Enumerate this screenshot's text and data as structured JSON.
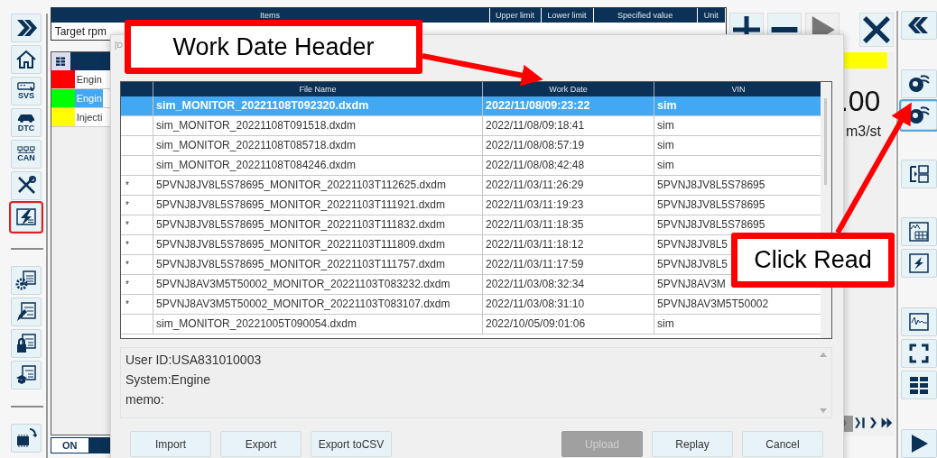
{
  "left_toolbar": {
    "groups": [
      [
        {
          "kind": "forward",
          "selected": false
        },
        {
          "kind": "home",
          "selected": false
        },
        {
          "kind": "svs",
          "label": "SVS",
          "selected": false
        },
        {
          "kind": "dtc",
          "label": "DTC",
          "selected": false
        },
        {
          "kind": "can",
          "label": "CAN",
          "selected": false
        },
        {
          "kind": "tools",
          "selected": false
        },
        {
          "kind": "monitor",
          "selected": true
        }
      ],
      [
        {
          "kind": "settings-list",
          "selected": false
        },
        {
          "kind": "edit-list",
          "selected": false
        },
        {
          "kind": "lock-list",
          "selected": false
        },
        {
          "kind": "learn-list",
          "selected": false
        }
      ],
      [
        {
          "kind": "chip",
          "selected": false
        }
      ]
    ]
  },
  "params_table": {
    "columns": [
      "Items",
      "Upper limit",
      "Lower limit",
      "Specified value",
      "Unit"
    ],
    "row_label": "Target rpm"
  },
  "signals": [
    {
      "color": "#ff0000",
      "label": "Engin",
      "selected": false
    },
    {
      "color": "#00ff00",
      "label": "Engin",
      "selected": true
    },
    {
      "color": "#ffff00",
      "label": "Injecti",
      "selected": false
    }
  ],
  "mode_buttons": [
    {
      "label": "ON",
      "selected": false
    },
    {
      "selected": true
    }
  ],
  "top_buttons": [
    {
      "kind": "add",
      "disabled": false
    },
    {
      "kind": "remove",
      "disabled": false
    },
    {
      "kind": "play",
      "disabled": true
    },
    {
      "kind": "close",
      "disabled": false
    }
  ],
  "value_panel": {
    "value": ".00",
    "unit": "m3/st"
  },
  "page_nav": [
    {
      "kind": "first",
      "disabled": true
    },
    {
      "kind": "last",
      "disabled": false
    },
    {
      "kind": "next",
      "disabled": false
    },
    {
      "kind": "fast",
      "disabled": false
    }
  ],
  "right_toolbar": {
    "groups": [
      [
        {
          "kind": "back",
          "selected": false
        }
      ],
      [
        {
          "kind": "disc",
          "selected": false
        },
        {
          "kind": "disc",
          "selected": true
        }
      ],
      [
        {
          "kind": "transfer",
          "selected": false
        }
      ],
      [
        {
          "kind": "graph-table",
          "selected": false
        },
        {
          "kind": "lightning",
          "selected": false
        }
      ],
      [
        {
          "kind": "waveform",
          "selected": false
        },
        {
          "kind": "fullscreen",
          "selected": false
        },
        {
          "kind": "grid",
          "selected": false
        }
      ],
      [
        {
          "kind": "play",
          "selected": false
        }
      ]
    ]
  },
  "dialog": {
    "title": "[D",
    "columns": [
      "File Name",
      "Work Date",
      "VIN"
    ],
    "rows": [
      {
        "file": "sim_MONITOR_20221108T092320.dxdm",
        "date": "2022/11/08/09:23:22",
        "vin": "sim",
        "selected": true
      },
      {
        "file": "sim_MONITOR_20221108T091518.dxdm",
        "date": "2022/11/08/09:18:41",
        "vin": "sim",
        "selected": false
      },
      {
        "file": "sim_MONITOR_20221108T085718.dxdm",
        "date": "2022/11/08/08:57:19",
        "vin": "sim",
        "selected": false
      },
      {
        "file": "sim_MONITOR_20221108T084246.dxdm",
        "date": "2022/11/08/08:42:48",
        "vin": "sim",
        "selected": false
      },
      {
        "mark": "*",
        "file": "5PVNJ8JV8L5S78695_MONITOR_20221103T112625.dxdm",
        "date": "2022/11/03/11:26:29",
        "vin": "5PVNJ8JV8L5S78695",
        "selected": false
      },
      {
        "mark": "*",
        "file": "5PVNJ8JV8L5S78695_MONITOR_20221103T111921.dxdm",
        "date": "2022/11/03/11:19:23",
        "vin": "5PVNJ8JV8L5S78695",
        "selected": false
      },
      {
        "mark": "*",
        "file": "5PVNJ8JV8L5S78695_MONITOR_20221103T111832.dxdm",
        "date": "2022/11/03/11:18:35",
        "vin": "5PVNJ8JV8L5S78695",
        "selected": false
      },
      {
        "mark": "*",
        "file": "5PVNJ8JV8L5S78695_MONITOR_20221103T111809.dxdm",
        "date": "2022/11/03/11:18:12",
        "vin": "5PVNJ8JV8L5",
        "selected": false
      },
      {
        "mark": "*",
        "file": "5PVNJ8JV8L5S78695_MONITOR_20221103T111757.dxdm",
        "date": "2022/11/03/11:17:59",
        "vin": "5PVNJ8JV8L5",
        "selected": false
      },
      {
        "mark": "*",
        "file": "5PVNJ8AV3M5T50002_MONITOR_20221103T083232.dxdm",
        "date": "2022/11/03/08:32:34",
        "vin": "5PVNJ8AV3M",
        "selected": false
      },
      {
        "mark": "*",
        "file": "5PVNJ8AV3M5T50002_MONITOR_20221103T083107.dxdm",
        "date": "2022/11/03/08:31:10",
        "vin": "5PVNJ8AV3M5T50002",
        "selected": false
      },
      {
        "file": "sim_MONITOR_20221005T090054.dxdm",
        "date": "2022/10/05/09:01:06",
        "vin": "sim",
        "selected": false
      }
    ],
    "details": [
      "User ID:USA831010003",
      "System:Engine",
      "memo:"
    ],
    "buttons": [
      {
        "label": "Import",
        "disabled": false
      },
      {
        "label": "Export",
        "disabled": false
      },
      {
        "label": "Export toCSV",
        "disabled": false
      },
      {
        "label": "Upload",
        "disabled": true
      },
      {
        "label": "Replay",
        "disabled": false
      },
      {
        "label": "Cancel",
        "disabled": false
      }
    ]
  },
  "annotations": [
    {
      "text": "Work Date Header"
    },
    {
      "text": "Click Read"
    }
  ]
}
